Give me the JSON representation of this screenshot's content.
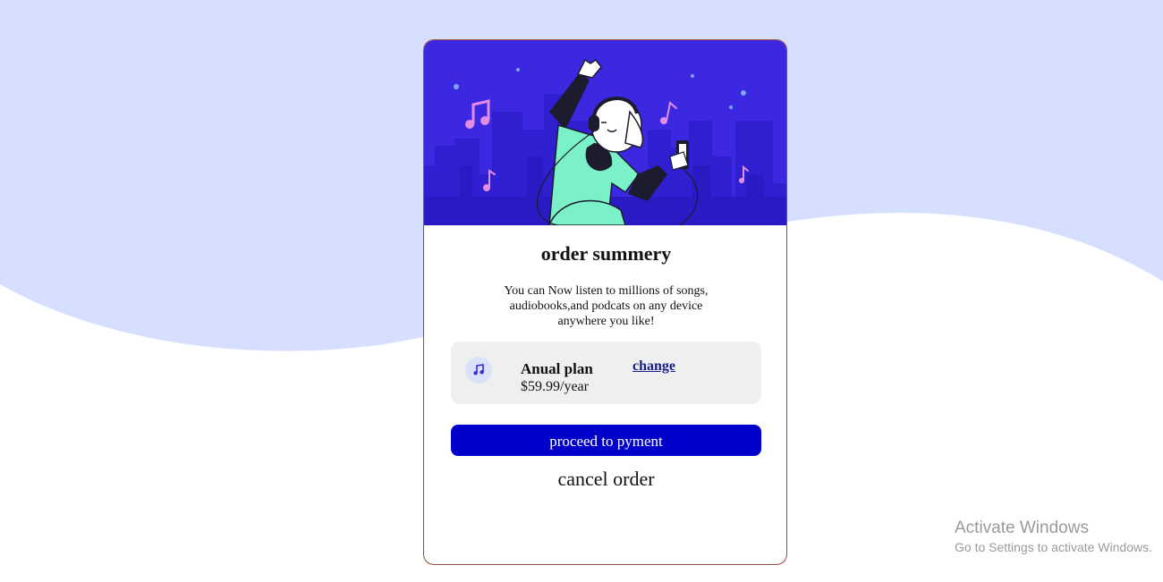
{
  "colors": {
    "background_wave": "#d6e0fe",
    "card_border": "#9b4a43",
    "hero_bg": "#3b28e0",
    "button_bg": "#0100cb",
    "plan_box_bg": "#efefef",
    "change_link": "#17208a"
  },
  "card": {
    "title": "order summery",
    "description": "You can Now listen to millions of songs, audiobooks,and podcats on any device anywhere you like!",
    "plan": {
      "icon": "music-note-icon",
      "name": "Anual plan",
      "price": "$59.99/year",
      "change_label": "change"
    },
    "proceed_label": "proceed to pyment",
    "cancel_label": "cancel order"
  },
  "watermark": {
    "line1": "Activate Windows",
    "line2": "Go to Settings to activate Windows."
  }
}
